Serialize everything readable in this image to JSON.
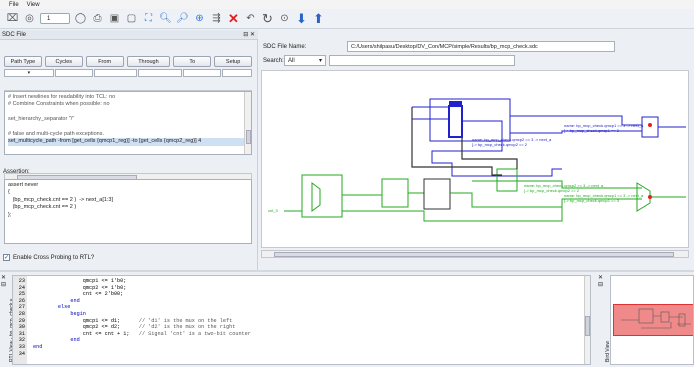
{
  "menu": {
    "file": "File",
    "view": "View"
  },
  "toolbar": {
    "step_value": "1"
  },
  "sdc_panel": {
    "title": "SDC File",
    "table_headers": [
      "Path Type",
      "Cycles",
      "From",
      "Through",
      "To",
      "Setup"
    ],
    "editor_lines": [
      "# Insert newlines for readability into TCL: no",
      "# Combine Constraints when possible: no",
      "",
      "set_hierarchy_separator \"/\"",
      "",
      "# false and multi-cycle path exceptions.",
      "set_multicycle_path -from [get_cells {qmcp1_reg}] -to [get_cells {qmcp2_reg}] 4"
    ],
    "assertion_label": "Assertion:",
    "assertion_lines": [
      "assert never",
      "{",
      "   (bp_mcp_check.cnt == 2 )  -> next_a[1:3]",
      "   (bp_mcp_check.cnt == 2 )",
      "};"
    ],
    "cross_probe_label": "Enable Cross Probing to RTL?"
  },
  "schematic": {
    "file_name_label": "SDC File Name:",
    "file_path": "C:/Users/shilpasu/Desktop/DV_Con/MCP/simple/Results/bp_mcp_check.sdc",
    "search_label": "Search:",
    "search_scope": "All",
    "labels": {
      "lbl1": "name: bp_mcp_check.qmcp1 == 3 -> next_a",
      "lbl2": "[-> bp_mcp_check.qmcp1 == 2",
      "lbl3": "name: bp_mcp_check.qmcp2 == 3 -> next_a",
      "lbl4": "[-> bp_mcp_check.qmcp2 == 2",
      "lbl5": "name: bp_mcp_check.qmcp1 == 3 -> next_a",
      "lbl6": "[-> bp_mcp_check.qmcp1 == 3",
      "lbl7": "name: bp_mcp_check.qmcp2 == 3 -> next_a",
      "lbl8": "[-> bp_mcp_check.qmcp2 == 2",
      "lbl9": "cnt_3"
    }
  },
  "code_view": {
    "side_label": "RTL View - bp_mcp_check.v",
    "lines": [
      {
        "n": "23",
        "t": "                qmcp1 <= 1'b0;"
      },
      {
        "n": "24",
        "t": "                qmcp2 <= 1'b0;"
      },
      {
        "n": "25",
        "t": "                cnt <= 2'b00;"
      },
      {
        "n": "26",
        "t": "            end"
      },
      {
        "n": "27",
        "t": "        else"
      },
      {
        "n": "28",
        "t": "            begin"
      },
      {
        "n": "29",
        "t": "                qmcp1 <= d1;      // 'd1' is the mux on the left"
      },
      {
        "n": "30",
        "t": "                qmcp2 <= d2;      // 'd2' is the mux on the right"
      },
      {
        "n": "31",
        "t": "                cnt <= cnt + 1;   // Signal 'cnt' is a two-bit counter"
      },
      {
        "n": "32",
        "t": "            end"
      },
      {
        "n": "33",
        "t": "end"
      },
      {
        "n": "34",
        "t": ""
      }
    ]
  },
  "bird_view": {
    "side_label": "Bird View"
  },
  "colors": {
    "accent_blue": "#3a77d6",
    "net_blue": "#2222cc",
    "net_green": "#22aa22",
    "overview_red": "#f08a8a"
  }
}
